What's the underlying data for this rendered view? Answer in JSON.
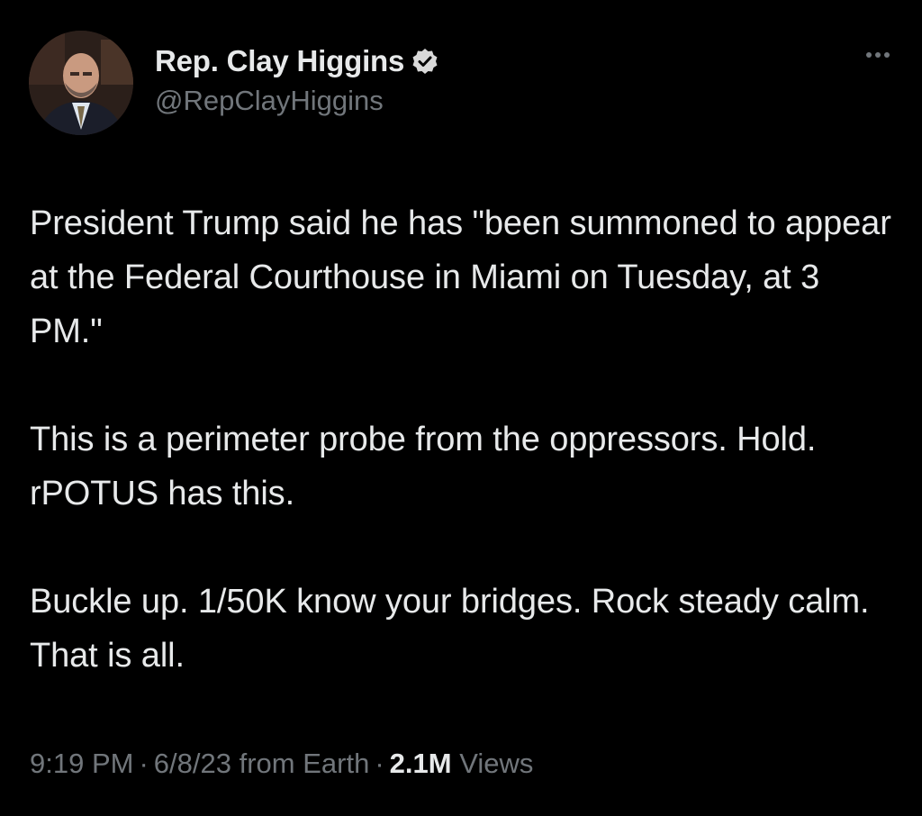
{
  "author": {
    "display_name": "Rep. Clay Higgins",
    "handle": "@RepClayHiggins",
    "verified_icon": "verified-badge-icon",
    "avatar_icon": "profile-photo"
  },
  "tweet": {
    "paragraphs": [
      "President Trump said he has \"been summoned to appear at the Federal Courthouse in Miami on Tuesday, at 3 PM.\"",
      "This is a perimeter probe from the oppressors. Hold. rPOTUS has this.",
      "Buckle up. 1/50K know your bridges. Rock steady calm. That is all."
    ]
  },
  "meta": {
    "time": "9:19 PM",
    "separator": "·",
    "date": "6/8/23",
    "source": "from Earth",
    "views_count": "2.1M",
    "views_label": "Views"
  },
  "colors": {
    "background": "#000000",
    "primary_text": "#e7e9ea",
    "secondary_text": "#71767b",
    "verified_badge": "#d9d9d9"
  }
}
